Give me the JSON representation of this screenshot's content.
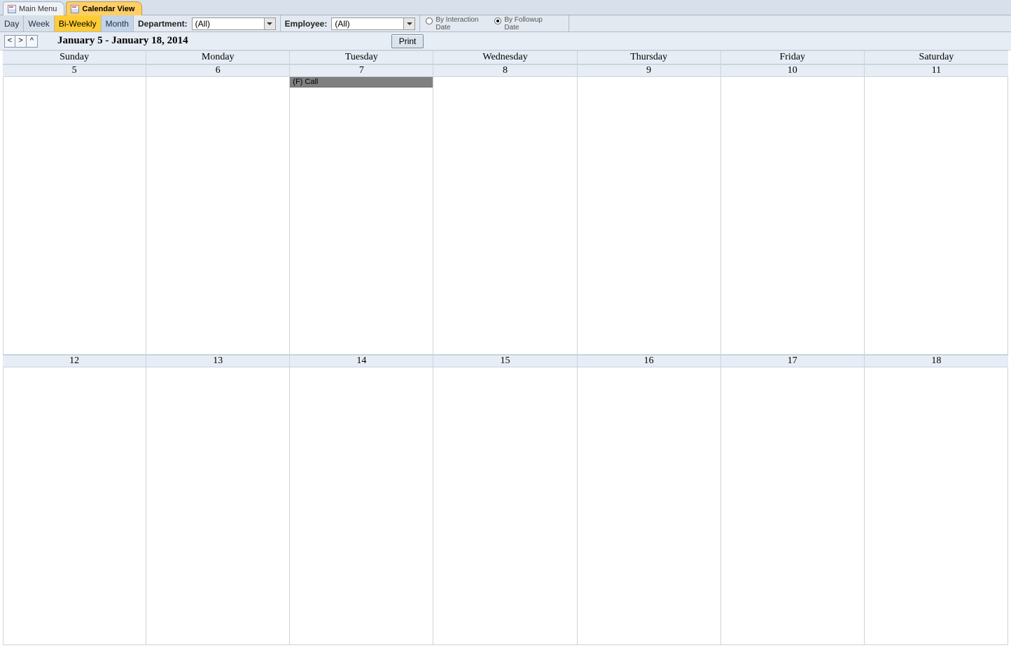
{
  "tabs": [
    {
      "label": "Main Menu",
      "active": false
    },
    {
      "label": "Calendar View",
      "active": true
    }
  ],
  "viewButtons": {
    "day": "Day",
    "week": "Week",
    "biweekly": "Bi-Weekly",
    "month": "Month",
    "selected": "biweekly"
  },
  "filters": {
    "departmentLabel": "Department:",
    "departmentValue": "(All)",
    "employeeLabel": "Employee:",
    "employeeValue": "(All)"
  },
  "radios": {
    "byInteraction": "By Interaction Date",
    "byFollowup": "By Followup Date",
    "selected": "byFollowup"
  },
  "nav": {
    "prev": "<",
    "next": ">",
    "up": "^",
    "dateRange": "January 5 - January 18, 2014",
    "print": "Print"
  },
  "daysOfWeek": [
    "Sunday",
    "Monday",
    "Tuesday",
    "Wednesday",
    "Thursday",
    "Friday",
    "Saturday"
  ],
  "weeks": [
    {
      "dates": [
        "5",
        "6",
        "7",
        "8",
        "9",
        "10",
        "11"
      ],
      "events": [
        {
          "dayIndex": 2,
          "text": "(F) Call"
        }
      ]
    },
    {
      "dates": [
        "12",
        "13",
        "14",
        "15",
        "16",
        "17",
        "18"
      ],
      "events": []
    }
  ]
}
